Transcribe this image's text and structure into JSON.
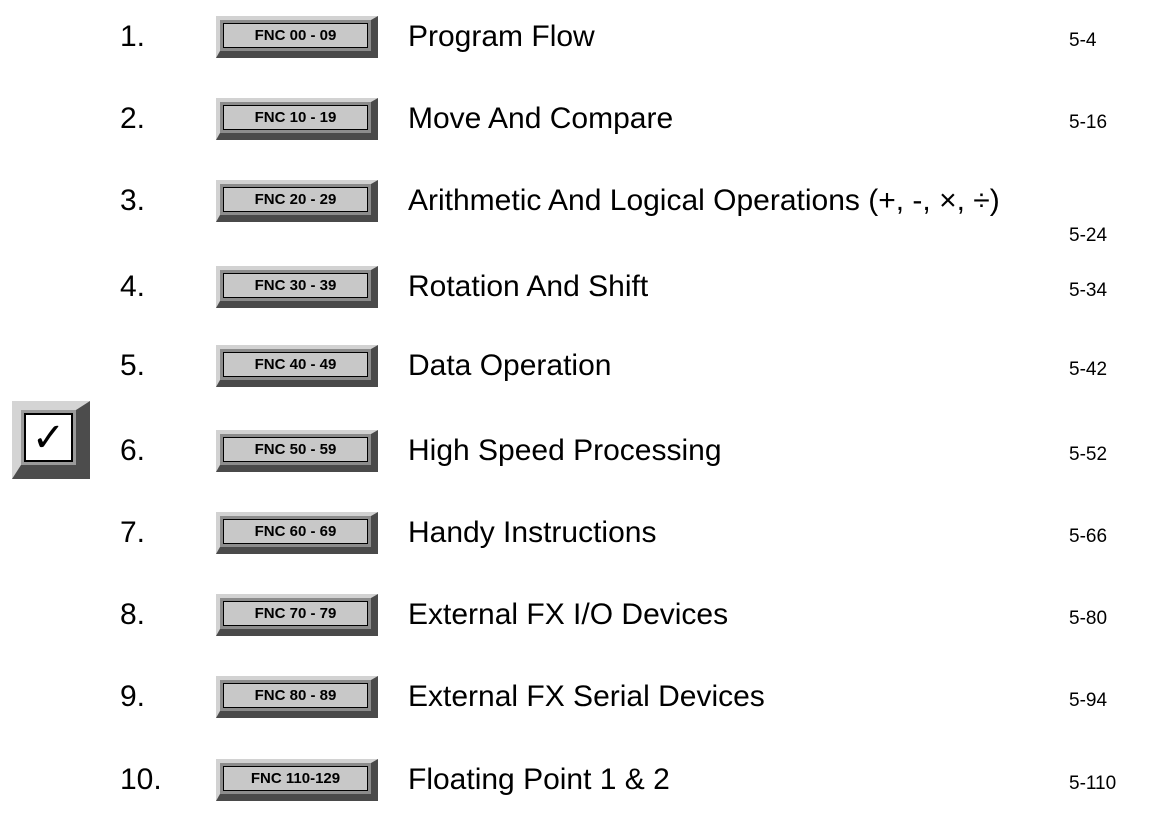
{
  "checkbox": {
    "checked": true,
    "glyph": "✓",
    "row_index": 5
  },
  "items": [
    {
      "number": "1.",
      "code": "FNC 00 - 09",
      "title": "Program Flow",
      "page": "5-4"
    },
    {
      "number": "2.",
      "code": "FNC 10 - 19",
      "title": "Move And Compare",
      "page": "5-16"
    },
    {
      "number": "3.",
      "code": "FNC 20 - 29",
      "title": "Arithmetic And Logical Operations (+, -, ×, ÷)",
      "page": "5-24"
    },
    {
      "number": "4.",
      "code": "FNC 30 - 39",
      "title": "Rotation And Shift",
      "page": "5-34"
    },
    {
      "number": "5.",
      "code": "FNC 40 - 49",
      "title": "Data Operation",
      "page": "5-42"
    },
    {
      "number": "6.",
      "code": "FNC 50 - 59",
      "title": "High Speed Processing",
      "page": "5-52"
    },
    {
      "number": "7.",
      "code": "FNC 60 - 69",
      "title": "Handy Instructions",
      "page": "5-66"
    },
    {
      "number": "8.",
      "code": "FNC 70 - 79",
      "title": "External FX I/O Devices",
      "page": "5-80"
    },
    {
      "number": "9.",
      "code": "FNC 80 - 89",
      "title": "External FX Serial Devices",
      "page": "5-94"
    },
    {
      "number": "10.",
      "code": "FNC 110-129",
      "title": "Floating Point 1 & 2",
      "page": "5-110"
    }
  ]
}
